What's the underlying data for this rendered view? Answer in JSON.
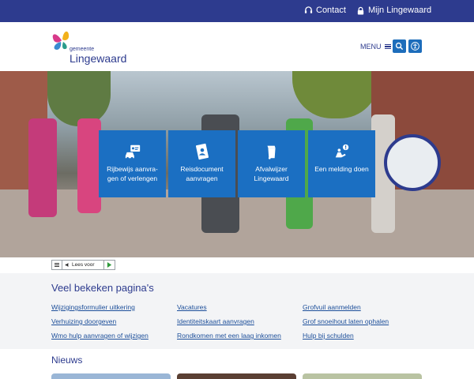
{
  "topbar": {
    "contact_label": "Contact",
    "mijn_label": "Mijn Lingewaard"
  },
  "header": {
    "logo_small": "gemeente",
    "logo_name": "Lingewaard",
    "menu_label": "MENU"
  },
  "tiles": [
    {
      "label_line1": "Rijbewijs aanvra-",
      "label_line2": "gen of verlengen",
      "icon": "drivers-license-icon"
    },
    {
      "label_line1": "Reisdocument",
      "label_line2": "aanvragen",
      "icon": "passport-icon"
    },
    {
      "label_line1": "Afvalwijzer",
      "label_line2": "Lingewaard",
      "icon": "waste-bin-icon"
    },
    {
      "label_line1": "Een melding doen",
      "label_line2": "",
      "icon": "report-issue-icon"
    }
  ],
  "readaloud": {
    "label": "Lees voor"
  },
  "popular": {
    "title": "Veel bekeken pagina's",
    "col1": [
      "Wijzigingsformulier uitkering",
      "Verhuizing doorgeven",
      "Wmo hulp aanvragen of wijzigen"
    ],
    "col2": [
      "Vacatures",
      "Identiteitskaart aanvragen",
      "Rondkomen met een laag inkomen"
    ],
    "col3": [
      "Grofvuil aanmelden",
      "Grof snoeihout laten ophalen",
      "Hulp bij schulden"
    ]
  },
  "news": {
    "title": "Nieuws"
  },
  "colors": {
    "brand_dark": "#2d3b8e",
    "tile_blue": "#1b6fc2",
    "link": "#1d4f9a",
    "section_bg": "#f3f4f6"
  }
}
